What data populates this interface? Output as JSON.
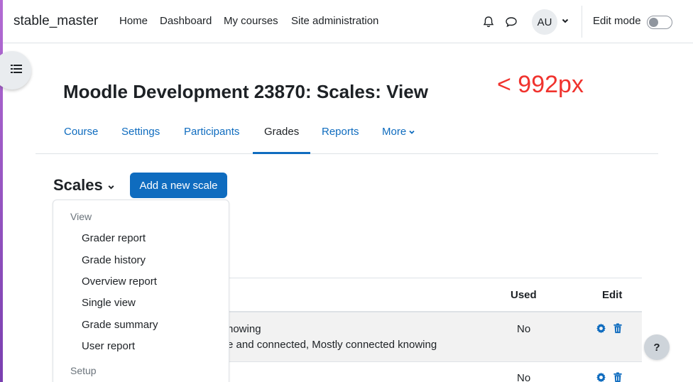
{
  "navbar": {
    "brand": "stable_master",
    "links": [
      "Home",
      "Dashboard",
      "My courses",
      "Site administration"
    ],
    "avatar_initials": "AU",
    "edit_mode_label": "Edit mode",
    "edit_mode_on": false
  },
  "page": {
    "title": "Moodle Development 23870: Scales: View",
    "annotation": "< 992px"
  },
  "secondary_nav": {
    "tabs": [
      "Course",
      "Settings",
      "Participants",
      "Grades",
      "Reports",
      "More"
    ],
    "active": "Grades"
  },
  "tertiary": {
    "title": "Scales",
    "add_button": "Add a new scale"
  },
  "dropdown": {
    "view_header": "View",
    "view_items": [
      "Grader report",
      "Grade history",
      "Overview report",
      "Single view",
      "Grade summary",
      "User report"
    ],
    "setup_header": "Setup"
  },
  "table": {
    "headers": {
      "used": "Used",
      "edit": "Edit"
    },
    "rows": [
      {
        "line1": "nowing",
        "line2": "e and connected, Mostly connected knowing",
        "used": "No"
      },
      {
        "used": "No"
      }
    ]
  },
  "help_label": "?",
  "colors": {
    "accent": "#0f6cbf",
    "annotation": "#f0322d"
  }
}
